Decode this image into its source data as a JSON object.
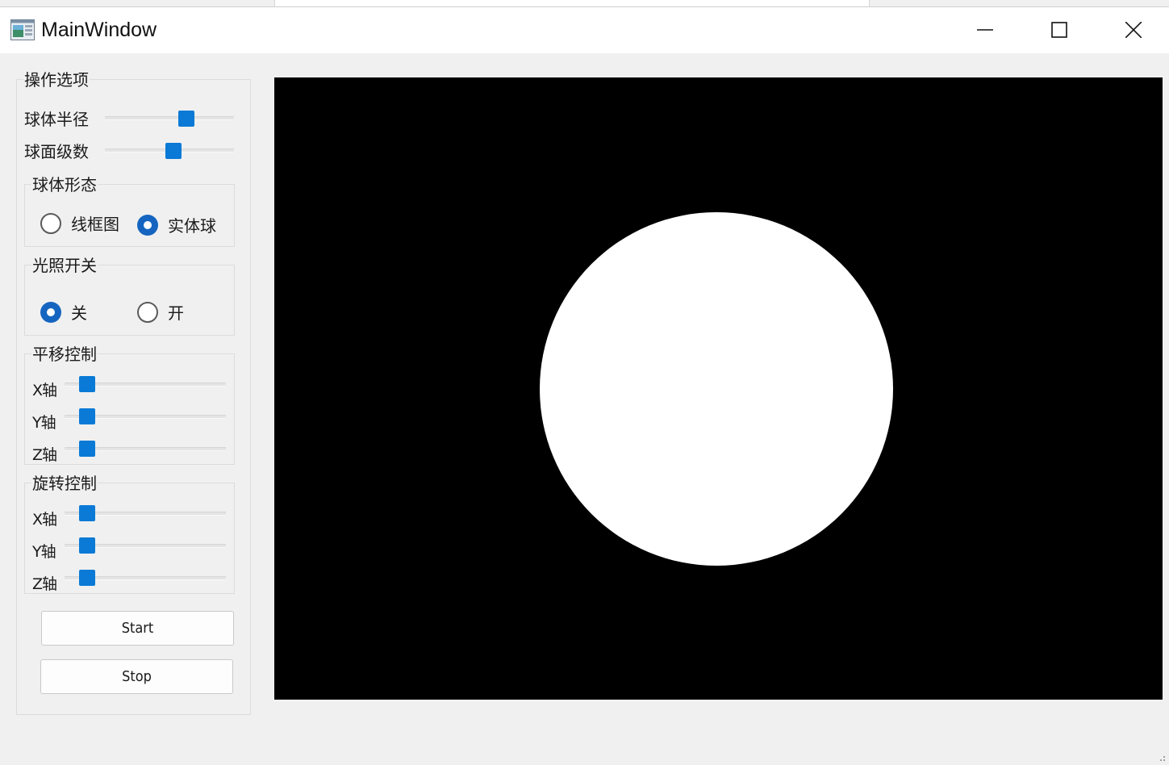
{
  "window": {
    "title": "MainWindow"
  },
  "titlebar": {
    "icon": "app-window-icon",
    "minimize_icon": "minimize-icon",
    "maximize_icon": "maximize-icon",
    "close_icon": "close-icon"
  },
  "options": {
    "title": "操作选项",
    "sphere_radius": {
      "label": "球体半径",
      "value_fraction": 0.7
    },
    "sphere_levels": {
      "label": "球面级数",
      "value_fraction": 0.55
    },
    "shape": {
      "title": "球体形态",
      "options": [
        {
          "label": "线框图",
          "checked": false
        },
        {
          "label": "实体球",
          "checked": true
        }
      ]
    },
    "lighting": {
      "title": "光照开关",
      "options": [
        {
          "label": "关",
          "checked": true
        },
        {
          "label": "开",
          "checked": false
        }
      ]
    },
    "translate": {
      "title": "平移控制",
      "axes": [
        {
          "label": "X轴",
          "value_fraction": 0.0
        },
        {
          "label": "Y轴",
          "value_fraction": 0.0
        },
        {
          "label": "Z轴",
          "value_fraction": 0.0
        }
      ]
    },
    "rotate": {
      "title": "旋转控制",
      "axes": [
        {
          "label": "X轴",
          "value_fraction": 0.0
        },
        {
          "label": "Y轴",
          "value_fraction": 0.0
        },
        {
          "label": "Z轴",
          "value_fraction": 0.0
        }
      ]
    },
    "start_label": "Start",
    "stop_label": "Stop"
  },
  "colors": {
    "accent": "#0a7ad6",
    "radio_checked": "#1565c0",
    "viewport_background": "#000000",
    "sphere": "#ffffff"
  }
}
